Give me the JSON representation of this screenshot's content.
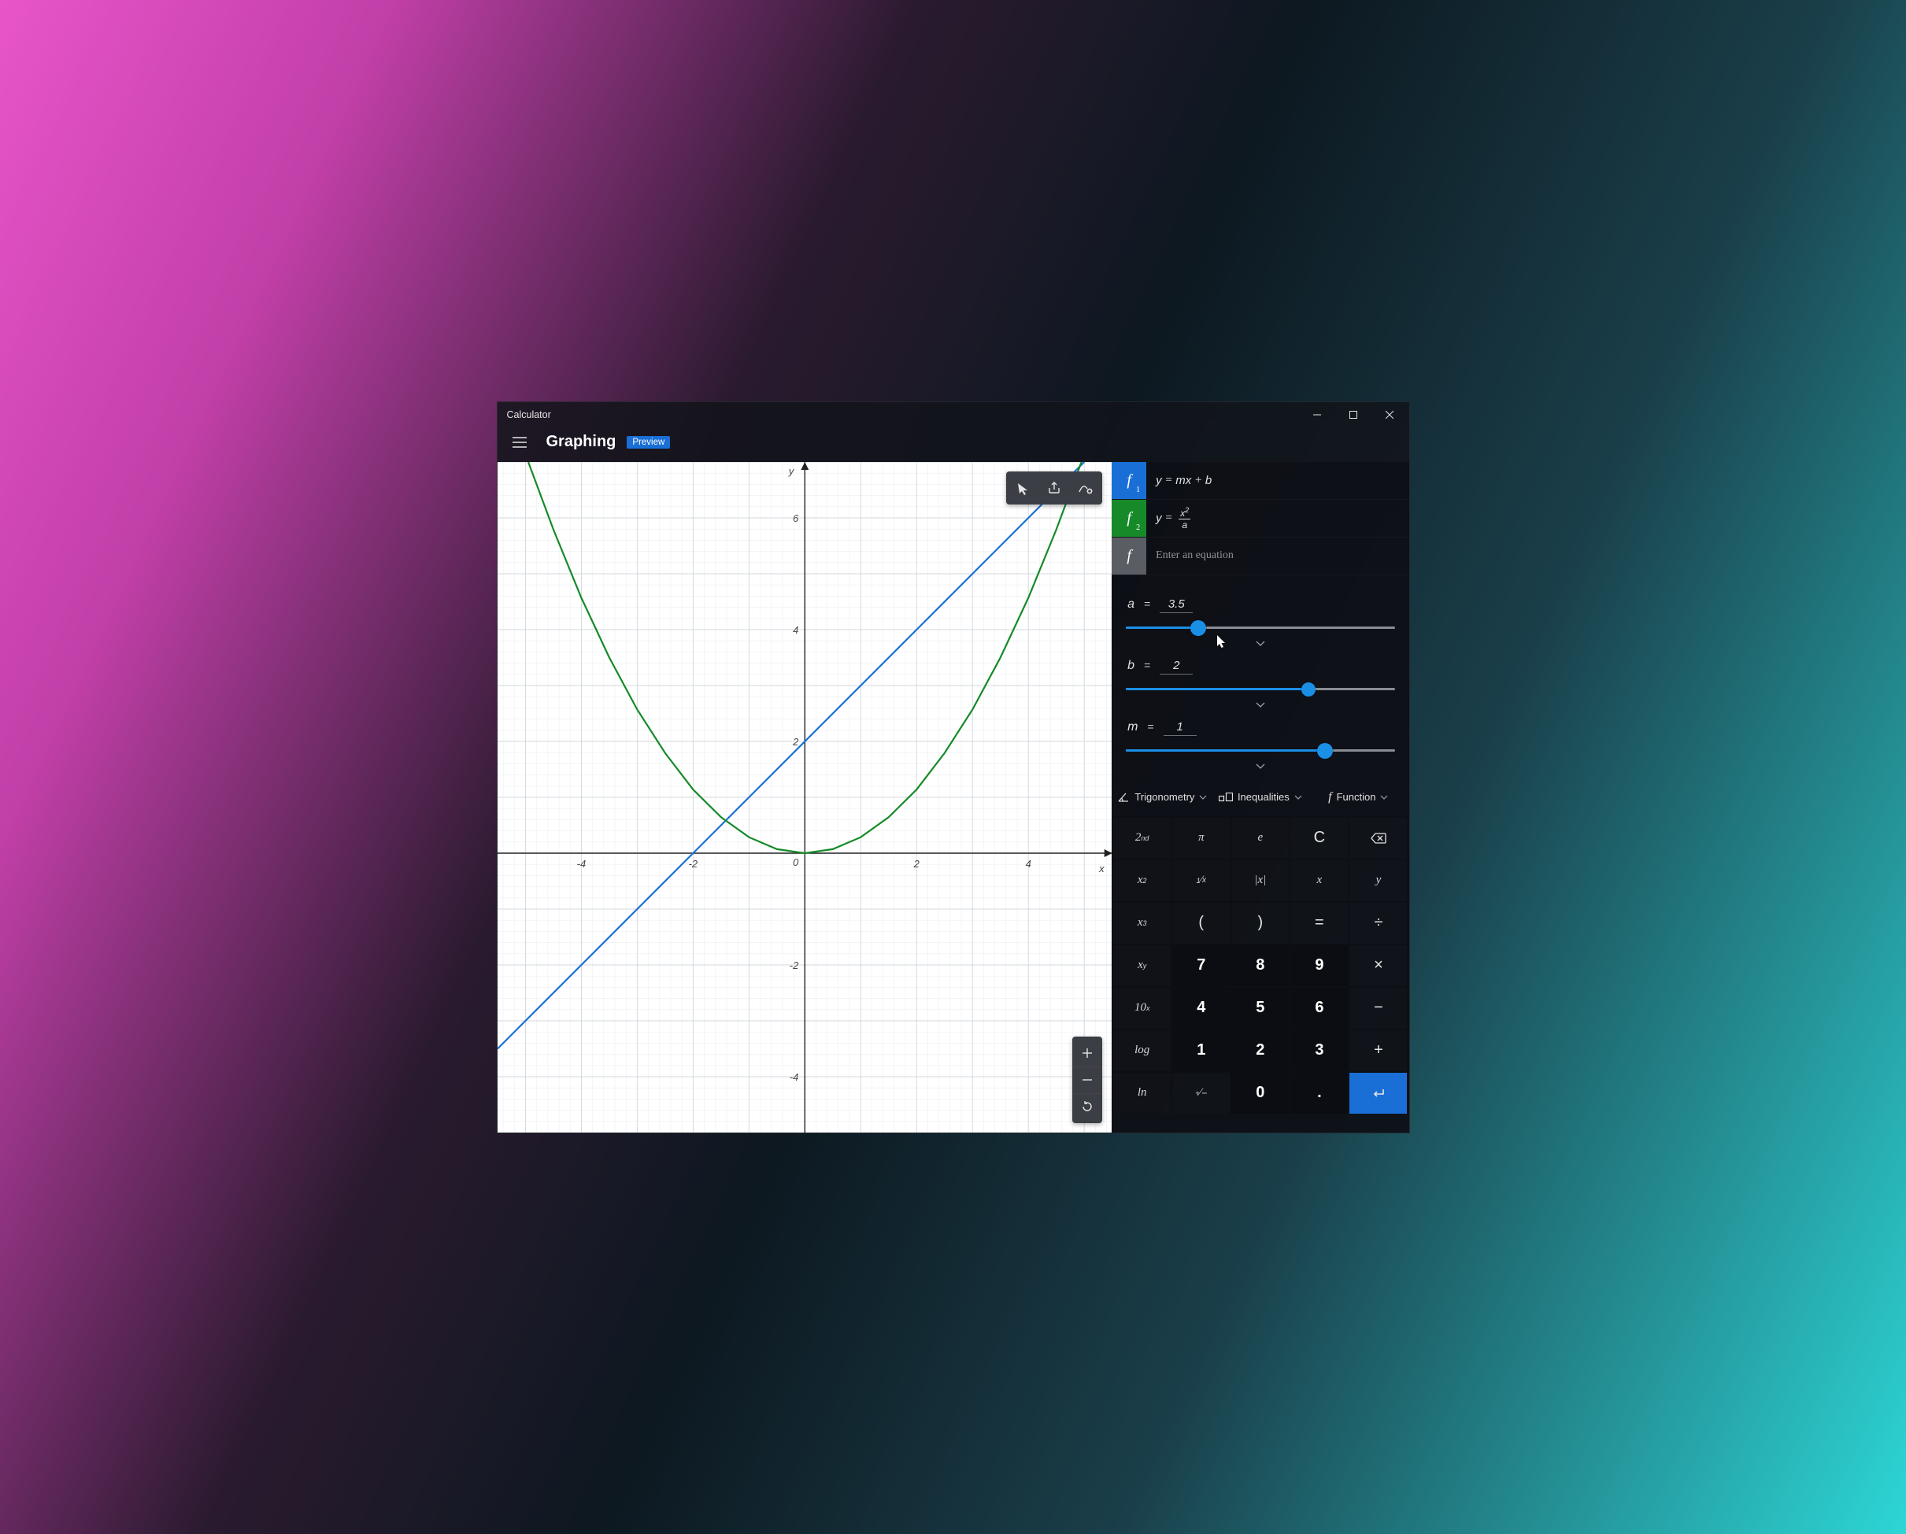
{
  "window": {
    "title": "Calculator"
  },
  "header": {
    "mode": "Graphing",
    "badge": "Preview"
  },
  "equations": [
    {
      "label": "f",
      "sub": "1",
      "color": "blue",
      "display_html": "y = mx + b"
    },
    {
      "label": "f",
      "sub": "2",
      "color": "green",
      "display_html": "y = x²/a"
    },
    {
      "label": "f",
      "sub": "",
      "color": "grey",
      "placeholder": "Enter an equation"
    }
  ],
  "variables": [
    {
      "name": "a",
      "value": "3.5",
      "fill_pct": 27,
      "thumb": "big"
    },
    {
      "name": "b",
      "value": "2",
      "fill_pct": 68,
      "thumb": ""
    },
    {
      "name": "m",
      "value": "1",
      "fill_pct": 74,
      "thumb": "big"
    }
  ],
  "func_tabs": [
    {
      "icon": "angle-icon",
      "label": "Trigonometry"
    },
    {
      "icon": "inequality-icon",
      "label": "Inequalities"
    },
    {
      "icon": "function-f-icon",
      "label": "Function"
    }
  ],
  "keypad": [
    [
      "2ⁿᵈ",
      "π",
      "e",
      "C",
      "⌫"
    ],
    [
      "x²",
      "¹⁄ₓ",
      "|x|",
      "x",
      "y"
    ],
    [
      "x³",
      "(",
      ")",
      "=",
      "÷"
    ],
    [
      "xʸ",
      "7",
      "8",
      "9",
      "×"
    ],
    [
      "10ˣ",
      "4",
      "5",
      "6",
      "−"
    ],
    [
      "log",
      "1",
      "2",
      "3",
      "+"
    ],
    [
      "ln",
      "⁺⁄₋",
      "0",
      ".",
      "↵"
    ]
  ],
  "keypad_meta": {
    "num_cells": [
      "7",
      "8",
      "9",
      "4",
      "5",
      "6",
      "1",
      "2",
      "3",
      "0",
      "."
    ],
    "accent_cells": [
      "↵"
    ]
  },
  "chart_data": {
    "type": "line",
    "xlabel": "x",
    "ylabel": "y",
    "xlim": [
      -5.5,
      5.5
    ],
    "ylim": [
      -5,
      7
    ],
    "x_ticks": [
      -4,
      -2,
      0,
      2,
      4
    ],
    "y_ticks": [
      -4,
      -2,
      0,
      2,
      4,
      6
    ],
    "grid_minor": 0.2,
    "grid_major": 1,
    "origin_label": "0",
    "series": [
      {
        "name": "y = m·x + b (m=1, b=2)",
        "color": "#1a6fd6",
        "kind": "polyline",
        "points": [
          [
            -5.5,
            -3.5
          ],
          [
            -5,
            -3
          ],
          [
            -4,
            -2
          ],
          [
            -3,
            -1
          ],
          [
            -2,
            0
          ],
          [
            -1,
            1
          ],
          [
            0,
            2
          ],
          [
            1,
            3
          ],
          [
            2,
            4
          ],
          [
            3,
            5
          ],
          [
            4,
            6
          ],
          [
            5,
            7
          ]
        ]
      },
      {
        "name": "y = x² / a (a=3.5)",
        "color": "#168a29",
        "kind": "polyline",
        "points": [
          [
            -4.95,
            7.0
          ],
          [
            -4.5,
            5.79
          ],
          [
            -4,
            4.57
          ],
          [
            -3.5,
            3.5
          ],
          [
            -3,
            2.57
          ],
          [
            -2.5,
            1.79
          ],
          [
            -2,
            1.14
          ],
          [
            -1.5,
            0.643
          ],
          [
            -1,
            0.286
          ],
          [
            -0.5,
            0.0714
          ],
          [
            0,
            0
          ],
          [
            0.5,
            0.0714
          ],
          [
            1,
            0.286
          ],
          [
            1.5,
            0.643
          ],
          [
            2,
            1.14
          ],
          [
            2.5,
            1.79
          ],
          [
            3,
            2.57
          ],
          [
            3.5,
            3.5
          ],
          [
            4,
            4.57
          ],
          [
            4.5,
            5.79
          ],
          [
            4.95,
            7.0
          ]
        ]
      }
    ]
  }
}
